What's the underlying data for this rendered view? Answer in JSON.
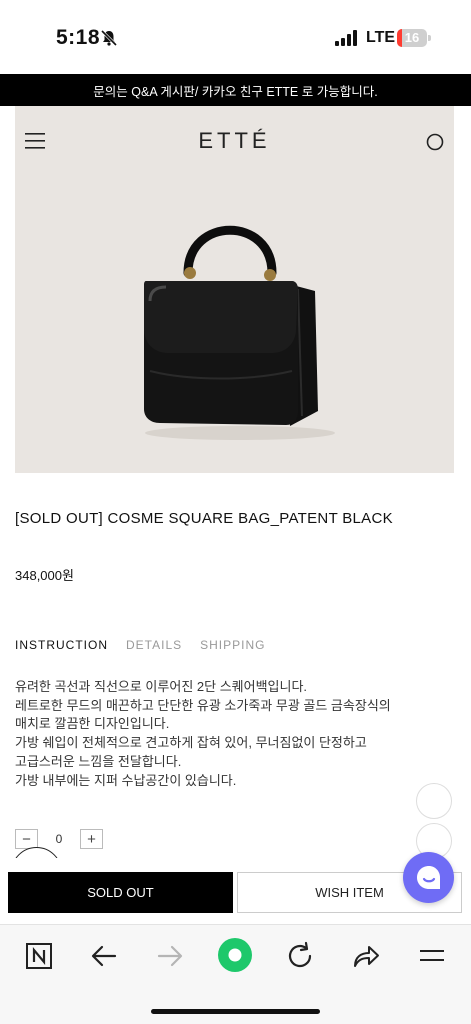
{
  "status_bar": {
    "time": "5:18",
    "network": "LTE",
    "battery": "16",
    "battery_level_percent": 16
  },
  "notice": {
    "text": "문의는 Q&A 게시판/ 카카오 친구 ETTE 로 가능합니다."
  },
  "header": {
    "brand": "ETTÉ"
  },
  "product": {
    "title": "[SOLD OUT] COSME SQUARE BAG_PATENT BLACK",
    "price": "348,000원"
  },
  "tabs": [
    {
      "label": "INSTRUCTION",
      "active": true
    },
    {
      "label": "DETAILS",
      "active": false
    },
    {
      "label": "SHIPPING",
      "active": false
    }
  ],
  "description": [
    "유려한 곡선과 직선으로 이루어진 2단 스퀘어백입니다.",
    "레트로한 무드의 매끈하고 단단한 유광 소가죽과 무광 골드 금속장식의",
    "매치로 깔끔한 디자인입니다.",
    "가방 쉐입이 전체적으로 견고하게 잡혀 있어, 무너짐없이 단정하고",
    "고급스러운 느낌을 전달합니다.",
    "가방 내부에는 지퍼 수납공간이 있습니다."
  ],
  "quantity": {
    "minus": "−",
    "value": "0",
    "plus": "+"
  },
  "floating": {
    "qa_label": "Q&A"
  },
  "actions": {
    "sold_out": "SOLD OUT",
    "wish": "WISH ITEM"
  },
  "colors": {
    "notice_bg": "#000000",
    "hero_bg": "#e9e5e1",
    "chat_accent": "#6f6cf5",
    "browser_green": "#1ec86b",
    "battery_low": "#ff3b30"
  },
  "icons": {
    "menu": "hamburger-menu-icon",
    "search": "search-icon",
    "chat": "chat-bubble-icon",
    "browser_home": "naver-n-icon",
    "back": "arrow-left-icon",
    "forward": "arrow-right-icon",
    "green_dot": "green-record-icon",
    "reload": "reload-icon",
    "share": "share-icon",
    "more": "more-menu-icon"
  }
}
